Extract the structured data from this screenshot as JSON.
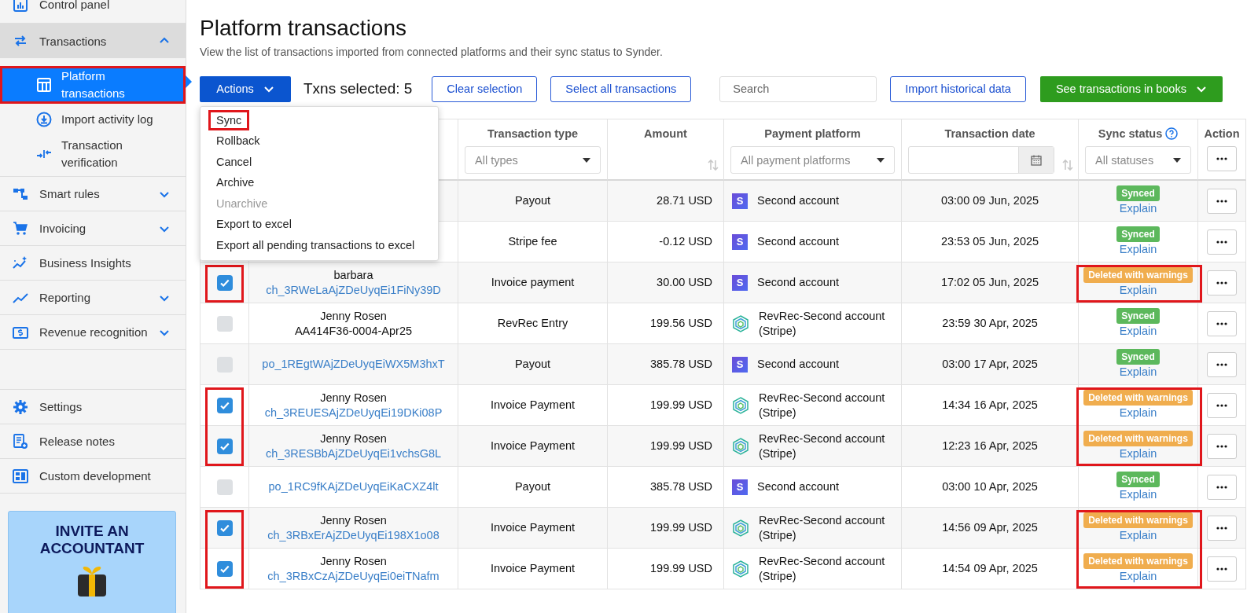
{
  "sidebar": {
    "items": [
      {
        "label": "Control panel",
        "expandable": false,
        "expanded": false
      },
      {
        "label": "Transactions",
        "expandable": true,
        "expanded": true,
        "children": [
          {
            "label": "Platform transactions",
            "selected": true,
            "highlighted": true
          },
          {
            "label": "Import activity log",
            "selected": false,
            "highlighted": false
          },
          {
            "label": "Transaction verification",
            "selected": false,
            "highlighted": false
          }
        ]
      },
      {
        "label": "Smart rules",
        "expandable": true,
        "expanded": false
      },
      {
        "label": "Invoicing",
        "expandable": true,
        "expanded": false
      },
      {
        "label": "Business Insights",
        "expandable": false,
        "expanded": false
      },
      {
        "label": "Reporting",
        "expandable": true,
        "expanded": false
      },
      {
        "label": "Revenue recognition",
        "expandable": true,
        "expanded": false
      }
    ],
    "bottom_items": [
      {
        "label": "Settings"
      },
      {
        "label": "Release notes"
      },
      {
        "label": "Custom development"
      }
    ],
    "promo": {
      "title": "INVITE AN ACCOUNTANT"
    }
  },
  "page": {
    "title": "Platform transactions",
    "subtitle": "View the list of transactions imported from connected platforms and their sync status to Synder."
  },
  "toolbar": {
    "actions_button": "Actions",
    "selected_count": "Txns selected: 5",
    "clear_button": "Clear selection",
    "select_all_button": "Select all transactions",
    "search": {
      "placeholder": "Search"
    },
    "import_button": "Import historical data",
    "books_button": "See transactions in books"
  },
  "actions_menu": {
    "open": true,
    "items": [
      {
        "label": "Sync",
        "disabled": false,
        "highlighted": true
      },
      {
        "label": "Rollback",
        "disabled": false,
        "highlighted": false
      },
      {
        "label": "Cancel",
        "disabled": false,
        "highlighted": false
      },
      {
        "label": "Archive",
        "disabled": false,
        "highlighted": false
      },
      {
        "label": "Unarchive",
        "disabled": true,
        "highlighted": false
      },
      {
        "label": "Export to excel",
        "disabled": false,
        "highlighted": false
      },
      {
        "label": "Export all pending transactions to excel",
        "disabled": false,
        "highlighted": false
      }
    ]
  },
  "table": {
    "columns": [
      {
        "label": "Transaction type",
        "kind": "select",
        "filter": "All types",
        "sortable": false
      },
      {
        "label": "Amount",
        "kind": "plain",
        "sortable": true
      },
      {
        "label": "Payment platform",
        "kind": "select",
        "filter": "All payment platforms",
        "sortable": false
      },
      {
        "label": "Transaction date",
        "kind": "date",
        "sortable": true
      },
      {
        "label": "Sync status",
        "kind": "select",
        "filter": "All statuses",
        "sortable": false,
        "help": true
      },
      {
        "label": "Action",
        "kind": "more",
        "sortable": false
      }
    ],
    "rows": [
      {
        "type": "Payout",
        "amount": "28.71 USD",
        "platform": {
          "kind": "stripe",
          "logo": "S",
          "name": "Second account"
        },
        "date": "03:00 09 Jun, 2025",
        "status": {
          "kind": "synced",
          "label": "Synced"
        },
        "explain": "Explain",
        "highlighted": false
      },
      {
        "type": "Stripe fee",
        "amount": "-0.12 USD",
        "platform": {
          "kind": "stripe",
          "logo": "S",
          "name": "Second account"
        },
        "date": "23:53 05 Jun, 2025",
        "status": {
          "kind": "synced",
          "label": "Synced"
        },
        "explain": "Explain",
        "highlighted": false
      },
      {
        "checked": true,
        "name": "barbara",
        "id": {
          "kind": "link",
          "text": "ch_3RWeLaAjZDeUyqEi1FiNy39D"
        },
        "type": "Invoice payment",
        "amount": "30.00 USD",
        "platform": {
          "kind": "stripe",
          "logo": "S",
          "name": "Second account"
        },
        "date": "17:02 05 Jun, 2025",
        "status": {
          "kind": "warning",
          "label": "Deleted with warnings"
        },
        "explain": "Explain",
        "highlighted": true
      },
      {
        "checked": false,
        "name": "Jenny Rosen",
        "id": {
          "kind": "plain",
          "text": "AA414F36-0004-Apr25"
        },
        "type": "RevRec Entry",
        "amount": "199.56 USD",
        "platform": {
          "kind": "revrec",
          "name": "RevRec-Second account (Stripe)"
        },
        "date": "23:59 30 Apr, 2025",
        "status": {
          "kind": "synced",
          "label": "Synced"
        },
        "explain": "Explain",
        "highlighted": false
      },
      {
        "checked": false,
        "id": {
          "kind": "link",
          "text": "po_1REgtWAjZDeUyqEiWX5M3hxT"
        },
        "type": "Payout",
        "amount": "385.78 USD",
        "platform": {
          "kind": "stripe",
          "logo": "S",
          "name": "Second account"
        },
        "date": "03:00 17 Apr, 2025",
        "status": {
          "kind": "synced",
          "label": "Synced"
        },
        "explain": "Explain",
        "highlighted": false
      },
      {
        "checked": true,
        "name": "Jenny Rosen",
        "id": {
          "kind": "link",
          "text": "ch_3REUESAjZDeUyqEi19DKi08P"
        },
        "type": "Invoice Payment",
        "amount": "199.99 USD",
        "platform": {
          "kind": "revrec",
          "name": "RevRec-Second account (Stripe)"
        },
        "date": "14:34 16 Apr, 2025",
        "status": {
          "kind": "warning",
          "label": "Deleted with warnings"
        },
        "explain": "Explain",
        "highlighted": true
      },
      {
        "checked": true,
        "name": "Jenny Rosen",
        "id": {
          "kind": "link",
          "text": "ch_3RESBbAjZDeUyqEi1vchsG8L"
        },
        "type": "Invoice Payment",
        "amount": "199.99 USD",
        "platform": {
          "kind": "revrec",
          "name": "RevRec-Second account (Stripe)"
        },
        "date": "12:23 16 Apr, 2025",
        "status": {
          "kind": "warning",
          "label": "Deleted with warnings"
        },
        "explain": "Explain",
        "highlighted": true
      },
      {
        "checked": false,
        "id": {
          "kind": "link",
          "text": "po_1RC9fKAjZDeUyqEiKaCXZ4lt"
        },
        "type": "Payout",
        "amount": "385.78 USD",
        "platform": {
          "kind": "stripe",
          "logo": "S",
          "name": "Second account"
        },
        "date": "03:00 10 Apr, 2025",
        "status": {
          "kind": "synced",
          "label": "Synced"
        },
        "explain": "Explain",
        "highlighted": false
      },
      {
        "checked": true,
        "name": "Jenny Rosen",
        "id": {
          "kind": "link",
          "text": "ch_3RBxErAjZDeUyqEi198X1o08"
        },
        "type": "Invoice Payment",
        "amount": "199.99 USD",
        "platform": {
          "kind": "revrec",
          "name": "RevRec-Second account (Stripe)"
        },
        "date": "14:56 09 Apr, 2025",
        "status": {
          "kind": "warning",
          "label": "Deleted with warnings"
        },
        "explain": "Explain",
        "highlighted": true
      },
      {
        "checked": true,
        "name": "Jenny Rosen",
        "id": {
          "kind": "link",
          "text": "ch_3RBxCzAjZDeUyqEi0eiTNafm"
        },
        "type": "Invoice Payment",
        "amount": "199.99 USD",
        "platform": {
          "kind": "revrec",
          "name": "RevRec-Second account (Stripe)"
        },
        "date": "14:54 09 Apr, 2025",
        "status": {
          "kind": "warning",
          "label": "Deleted with warnings"
        },
        "explain": "Explain",
        "highlighted": true
      }
    ]
  }
}
